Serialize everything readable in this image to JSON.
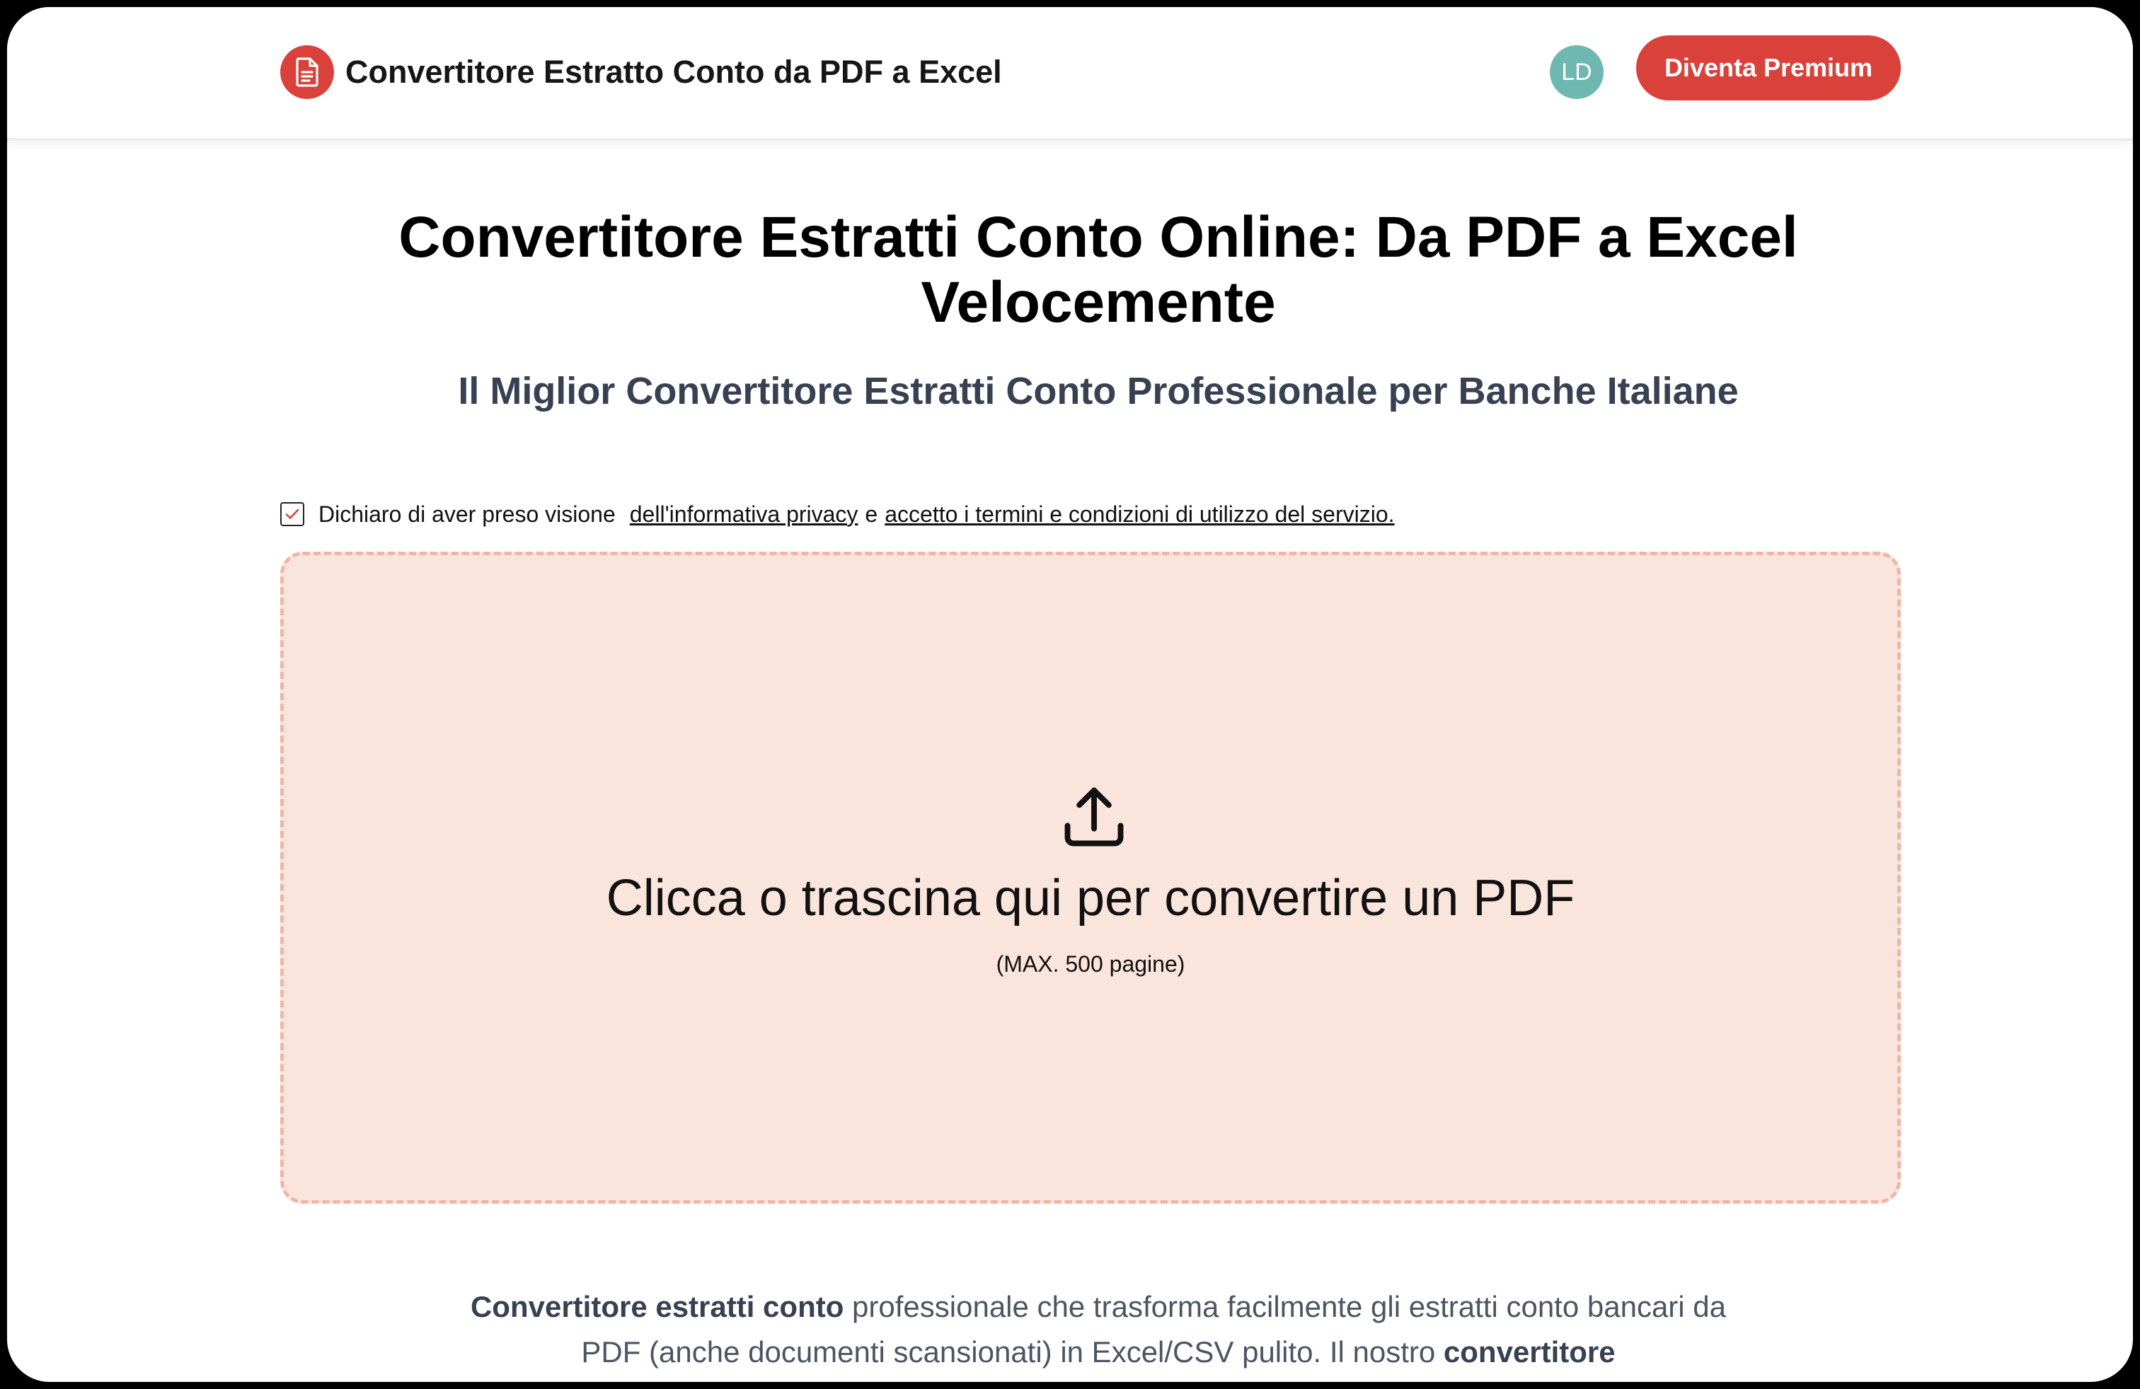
{
  "header": {
    "brand_title": "Convertitore Estratto Conto da PDF a Excel",
    "logo_icon": "document-icon",
    "avatar_initials": "LD",
    "premium_label": "Diventa Premium"
  },
  "hero": {
    "title": "Convertitore Estratti Conto Online: Da PDF a Excel Velocemente",
    "subtitle": "Il Miglior Convertitore Estratti Conto Professionale per Banche Italiane"
  },
  "consent": {
    "checked": true,
    "prefix": "Dichiaro di aver preso visione",
    "privacy_link": "dell'informativa privacy",
    "conjunction": "e",
    "terms_link": "accetto i termini e condizioni di utilizzo del servizio."
  },
  "upload": {
    "icon": "upload-icon",
    "prompt": "Clicca o trascina qui per convertire un PDF",
    "limit_note": "(MAX. 500 pagine)"
  },
  "description": {
    "bold_1": "Convertitore estratti conto",
    "text_1": " professionale che trasforma facilmente gli estratti conto bancari da PDF (anche documenti scansionati) in Excel/CSV pulito. Il nostro ",
    "bold_2": "convertitore"
  },
  "colors": {
    "accent": "#d9413a",
    "avatar": "#6fb7b1",
    "dropzone_bg": "#fae5dd",
    "dropzone_border": "#f0b5a6"
  }
}
